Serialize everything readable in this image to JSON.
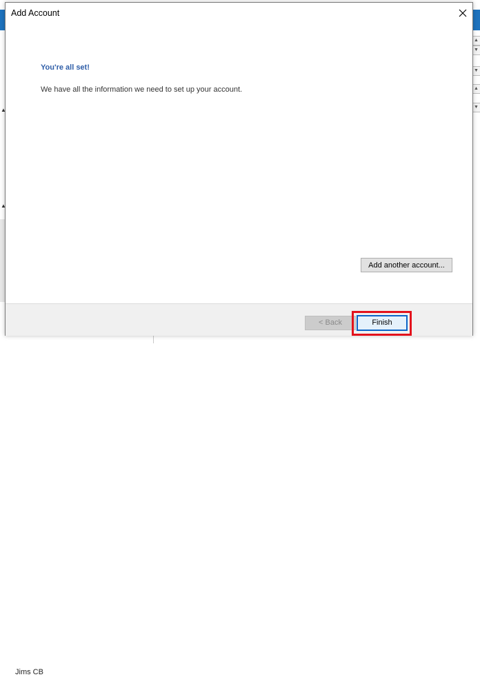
{
  "dialog": {
    "title": "Add Account",
    "heading": "You're all set!",
    "message": "We have all the information we need to set up your account.",
    "add_another_label": "Add another account...",
    "back_label": "< Back",
    "finish_label": "Finish",
    "close_icon": "close-icon",
    "highlight_color": "#e3121c",
    "heading_color": "#2f5ea8"
  },
  "background": {
    "folder_label": "Jims CB"
  }
}
